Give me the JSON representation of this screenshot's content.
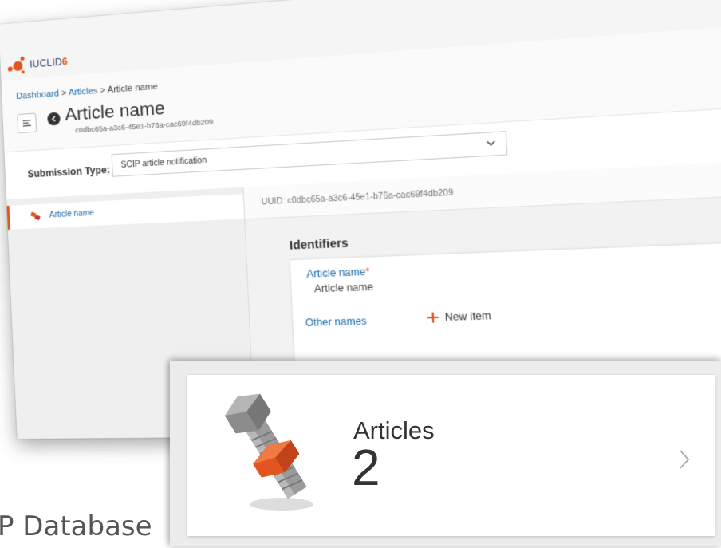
{
  "app": {
    "logo_text": "IUCLID",
    "logo_version": "6"
  },
  "breadcrumb": {
    "items": [
      "Dashboard",
      "Articles",
      "Article name"
    ],
    "separator": ">"
  },
  "header": {
    "title": "Article name",
    "uuid": "c0dbc65a-a3c6-45e1-b76a-cac69f4db209"
  },
  "submission": {
    "label": "Submission Type:",
    "value": "SCIP article notification"
  },
  "sidebar": {
    "items": [
      {
        "label": "Article name",
        "icon": "article-icon",
        "selected": true
      }
    ]
  },
  "content": {
    "uuid_line": "UUID: c0dbc65a-a3c6-45e1-b76a-cac69f4db209",
    "section_title": "Identifiers",
    "fields": {
      "article_name_label": "Article name",
      "article_name_required": "*",
      "article_name_value": "Article name",
      "other_names_label": "Other names",
      "new_item_label": "New item"
    }
  },
  "articles_card": {
    "label": "Articles",
    "count": "2",
    "icon": "bolt-nut-icon"
  },
  "footer": {
    "text": "P Database"
  },
  "colors": {
    "accent": "#e4541e",
    "link": "#1a6aa6",
    "text": "#333333"
  }
}
